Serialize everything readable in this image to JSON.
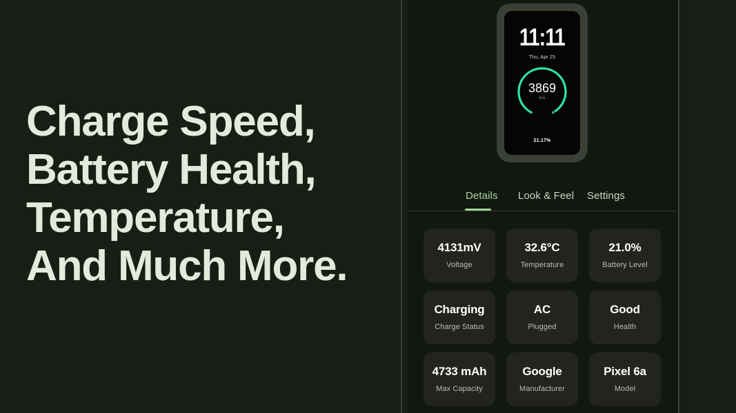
{
  "colors": {
    "page_bg": "#181D15",
    "app_bg": "#12170F",
    "card_bg": "#22251E",
    "hero_text": "#E4EADB",
    "accent_green": "#A2D59A",
    "gauge_green": "#2FE3A0",
    "divider": "#3C4238"
  },
  "hero": {
    "lines": [
      "Charge Speed,",
      "Battery Health,",
      "Temperature,",
      "And Much More."
    ]
  },
  "phone": {
    "clock_time": "11:11",
    "clock_date": "Thu, Apr 25",
    "gauge": {
      "value": "3869",
      "unit": "mA",
      "sweep_percent": 93
    },
    "battery_percent_label": "21.17%"
  },
  "tabs": {
    "items": [
      {
        "label": "Details",
        "active": true
      },
      {
        "label": "Look & Feel",
        "active": false
      },
      {
        "label": "Settings",
        "active": false
      }
    ]
  },
  "details_grid": {
    "cards": [
      {
        "value": "4131mV",
        "label": "Voltage"
      },
      {
        "value": "32.6°C",
        "label": "Temperature"
      },
      {
        "value": "21.0%",
        "label": "Battery Level"
      },
      {
        "value": "Charging",
        "label": "Charge Status"
      },
      {
        "value": "AC",
        "label": "Plugged"
      },
      {
        "value": "Good",
        "label": "Health"
      },
      {
        "value": "4733 mAh",
        "label": "Max Capacity"
      },
      {
        "value": "Google",
        "label": "Manufacturer"
      },
      {
        "value": "Pixel 6a",
        "label": "Model"
      }
    ]
  }
}
